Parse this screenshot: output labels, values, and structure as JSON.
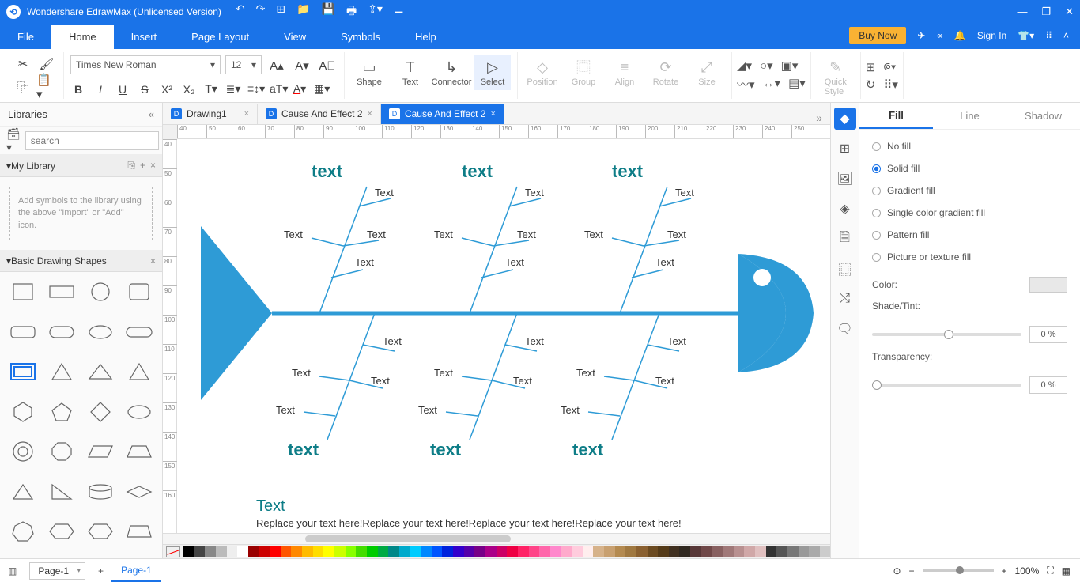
{
  "titlebar": {
    "app_name": "Wondershare EdrawMax (Unlicensed Version)"
  },
  "menus": {
    "file": "File",
    "home": "Home",
    "insert": "Insert",
    "page_layout": "Page Layout",
    "view": "View",
    "symbols": "Symbols",
    "help": "Help",
    "buy_now": "Buy Now",
    "sign_in": "Sign In"
  },
  "ribbon": {
    "font_name": "Times New Roman",
    "font_size": "12",
    "shape": "Shape",
    "text": "Text",
    "connector": "Connector",
    "select": "Select",
    "position": "Position",
    "group": "Group",
    "align": "Align",
    "rotate": "Rotate",
    "size": "Size",
    "quick_style": "Quick\nStyle"
  },
  "libraries": {
    "title": "Libraries",
    "search_placeholder": "search",
    "my_library": "My Library",
    "hint": "Add symbols to the library using the above \"Import\" or \"Add\" icon.",
    "basic_shapes": "Basic Drawing Shapes"
  },
  "tabs": [
    {
      "label": "Drawing1",
      "active": false
    },
    {
      "label": "Cause And Effect 2",
      "active": false
    },
    {
      "label": "Cause And Effect 2",
      "active": true
    }
  ],
  "ruler_h": [
    40,
    50,
    60,
    70,
    80,
    90,
    100,
    110,
    120,
    130,
    140,
    150,
    160,
    170,
    180,
    190,
    200,
    210,
    220,
    230,
    240,
    250
  ],
  "ruler_v": [
    40,
    50,
    60,
    70,
    80,
    90,
    100,
    110,
    120,
    130,
    140,
    150,
    160
  ],
  "diagram": {
    "top_categories": [
      "text",
      "text",
      "text"
    ],
    "bottom_categories": [
      "text",
      "text",
      "text"
    ],
    "sub": "Text",
    "caption_title": "Text",
    "caption_body": "Replace your text here!Replace your text here!Replace your text here!Replace your text here!"
  },
  "right_panel": {
    "tabs": {
      "fill": "Fill",
      "line": "Line",
      "shadow": "Shadow"
    },
    "options": {
      "no_fill": "No fill",
      "solid": "Solid fill",
      "gradient": "Gradient fill",
      "single": "Single color gradient fill",
      "pattern": "Pattern fill",
      "picture": "Picture or texture fill"
    },
    "color": "Color:",
    "shade": "Shade/Tint:",
    "transparency": "Transparency:",
    "pct": "0 %"
  },
  "statusbar": {
    "page_selector": "Page-1",
    "page_tab": "Page-1",
    "zoom": "100%"
  },
  "palette": [
    "#000",
    "#444",
    "#888",
    "#bbb",
    "#eee",
    "#fff",
    "#900",
    "#c00",
    "#f00",
    "#f50",
    "#f80",
    "#fb0",
    "#fd0",
    "#ff0",
    "#cf0",
    "#8f0",
    "#4d0",
    "#0c0",
    "#0a4",
    "#088",
    "#0ac",
    "#0cf",
    "#08f",
    "#05f",
    "#02d",
    "#30c",
    "#50a",
    "#708",
    "#a08",
    "#c06",
    "#e04",
    "#f26",
    "#f48",
    "#f6a",
    "#f8c",
    "#fac",
    "#fcd",
    "#fee",
    "#d6b28a",
    "#c8a070",
    "#b48a50",
    "#a07840",
    "#8a6030",
    "#6b4a20",
    "#543a18",
    "#403020",
    "#302820",
    "#583838",
    "#704848",
    "#886060",
    "#a07878",
    "#b89090",
    "#d0a8a8",
    "#e0c0c0",
    "#333",
    "#555",
    "#777",
    "#999",
    "#aaa",
    "#ccc"
  ]
}
